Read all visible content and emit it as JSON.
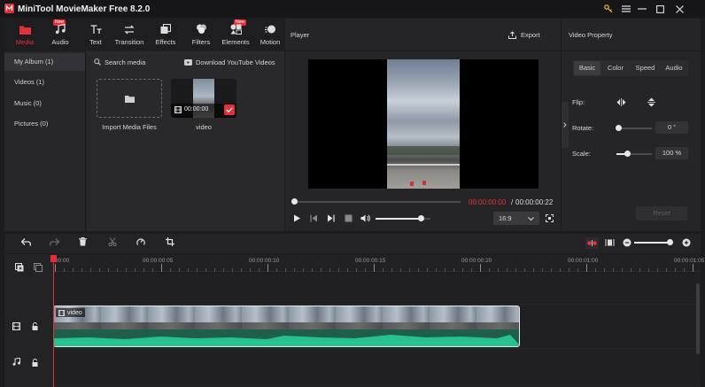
{
  "app": {
    "title": "MiniTool MovieMaker Free 8.2.0"
  },
  "toolbar": {
    "tools": [
      {
        "label": "Media",
        "icon": "folder-icon",
        "active": true
      },
      {
        "label": "Audio",
        "icon": "music-note-icon",
        "badge": "New"
      },
      {
        "label": "Text",
        "icon": "text-icon"
      },
      {
        "label": "Transition",
        "icon": "transition-arrows-icon"
      },
      {
        "label": "Effects",
        "icon": "effects-icon"
      },
      {
        "label": "Filters",
        "icon": "filters-icon"
      },
      {
        "label": "Elements",
        "icon": "elements-icon",
        "badge": "New"
      },
      {
        "label": "Motion",
        "icon": "motion-icon"
      }
    ]
  },
  "sidebar": {
    "items": [
      {
        "label": "My Album (1)",
        "active": true
      },
      {
        "label": "Videos (1)"
      },
      {
        "label": "Music (0)"
      },
      {
        "label": "Pictures (0)"
      }
    ]
  },
  "media": {
    "search_label": "Search media",
    "download_label": "Download YouTube Videos",
    "import_label": "Import Media Files",
    "clip_name": "video",
    "clip_duration": "00:00:00"
  },
  "player": {
    "title": "Player",
    "export_label": "Export",
    "current_time": "00:00:00:00",
    "separator": "/",
    "total_time": "00:00:00:22",
    "aspect_ratio": "16:9",
    "volume": 0.82,
    "progress": 0.0
  },
  "property": {
    "title": "Video Property",
    "tabs": [
      "Basic",
      "Color",
      "Speed",
      "Audio"
    ],
    "flip_label": "Flip:",
    "rotate_label": "Rotate:",
    "rotate_value": "0 °",
    "rotate_fraction": 0.06,
    "scale_label": "Scale:",
    "scale_value": "100 %",
    "scale_fraction": 0.3,
    "reset_label": "Reset"
  },
  "timeline": {
    "ruler_labels": [
      "00:00",
      "00:00:00:05",
      "00:00:00:10",
      "00:00:00:15",
      "00:00:00:20",
      "00:00:01:00",
      "00:00:01:05"
    ],
    "clip_label": "video",
    "zoom": 0.9
  },
  "colors": {
    "accent": "#e5303a",
    "audio_wave": "#27c18f",
    "clip_border": "#e9e9e9"
  }
}
